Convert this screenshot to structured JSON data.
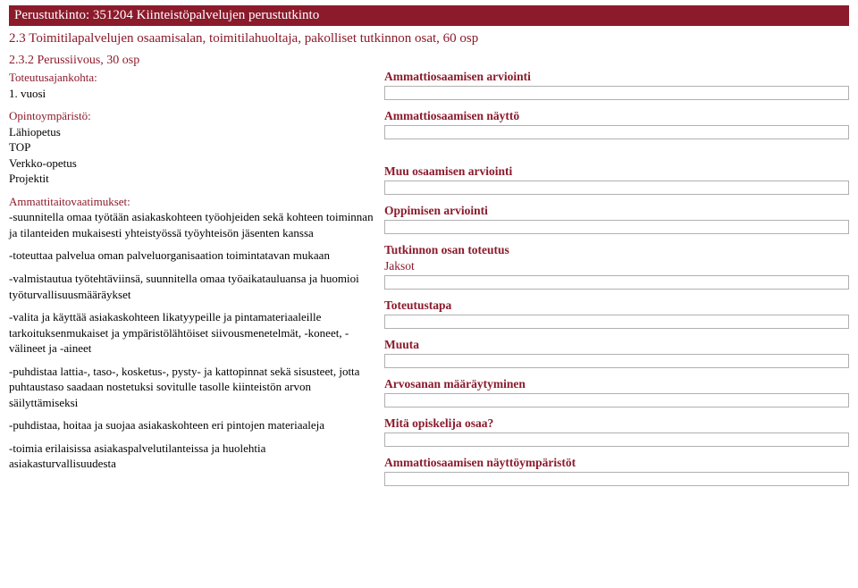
{
  "banner": "Perustutkinto: 351204 Kiinteistöpalvelujen perustutkinto",
  "subheading1": "2.3 Toimitilapalvelujen osaamisalan, toimitilahuoltaja, pakolliset tutkinnon osat, 60 osp",
  "subheading2": "2.3.2 Perussiivous, 30 osp",
  "left": {
    "toteutus_label": "Toteutusajankohta:",
    "toteutus_value": "1. vuosi",
    "opinto_label": "Opintoympäristö:",
    "opinto_values": [
      "Lähiopetus",
      "TOP",
      "Verkko-opetus",
      "Projektit"
    ],
    "atv_label": "Ammattitaitovaatimukset:",
    "atv_items": [
      "-suunnitella omaa työtään asiakaskohteen työohjeiden sekä kohteen toiminnan ja tilanteiden mukaisesti yhteistyössä työyhteisön jäsenten kanssa",
      "-toteuttaa palvelua oman palveluorganisaation toimintatavan mukaan",
      "-valmistautua työtehtäviinsä, suunnitella omaa työaikatauluansa ja huomioi työturvallisuusmääräykset",
      "-valita ja käyttää asiakaskohteen likatyypeille ja pintamateriaaleille tarkoituksenmukaiset ja ympäristölähtöiset siivousmenetelmät, -koneet, -välineet ja -aineet",
      "-puhdistaa lattia-, taso-, kosketus-, pysty- ja kattopinnat sekä sisusteet, jotta puhtaustaso saadaan nostetuksi sovitulle tasolle kiinteistön arvon säilyttämiseksi",
      "-puhdistaa, hoitaa ja suojaa asiakaskohteen eri pintojen materiaaleja",
      "-toimia erilaisissa asiakaspalvelutilanteissa ja huolehtia asiakasturvallisuudesta"
    ]
  },
  "right": {
    "groups": [
      {
        "heading": "Ammattiosaamisen arviointi"
      },
      {
        "heading": "Ammattiosaamisen näyttö"
      },
      {
        "heading": "Muu osaamisen arviointi"
      },
      {
        "heading": "Oppimisen arviointi"
      },
      {
        "heading": "Tutkinnon osan toteutus",
        "sub": "Jaksot"
      },
      {
        "heading": "Toteutustapa"
      },
      {
        "heading": "Muuta"
      },
      {
        "heading": "Arvosanan määräytyminen"
      },
      {
        "heading": "Mitä opiskelija osaa?"
      },
      {
        "heading": "Ammattiosaamisen näyttöympäristöt"
      }
    ]
  }
}
